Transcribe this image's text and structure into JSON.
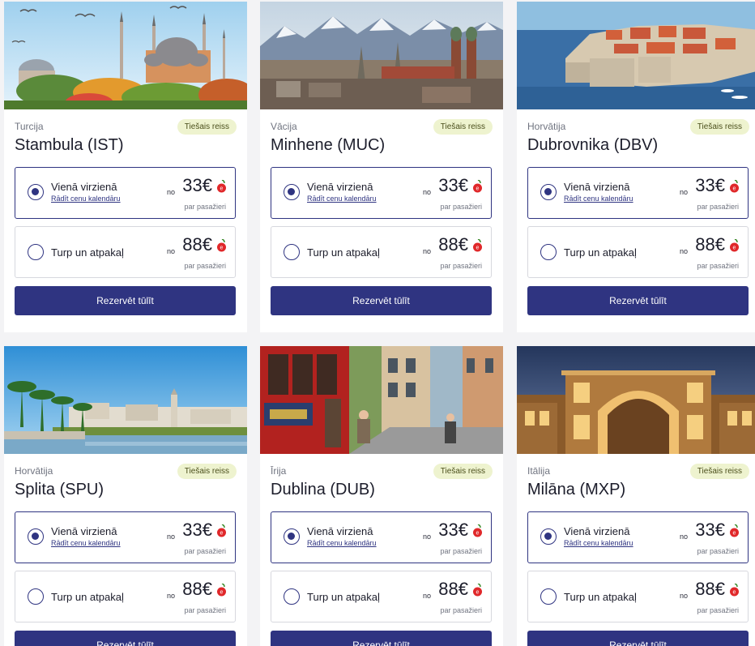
{
  "destinations": [
    {
      "country": "Turcija",
      "badge": "Tiešais reiss",
      "city": "Stambula (IST)",
      "oneway_label": "Vienā virzienā",
      "calendar_link": "Rādīt cenu kalendāru",
      "from": "no",
      "oneway_price": "33€",
      "per_passenger": "par pasažieri",
      "return_label": "Turp un atpakaļ",
      "return_price": "88€",
      "book_label": "Rezervēt tūlīt"
    },
    {
      "country": "Vācija",
      "badge": "Tiešais reiss",
      "city": "Minhene (MUC)",
      "oneway_label": "Vienā virzienā",
      "calendar_link": "Rādīt cenu kalendāru",
      "from": "no",
      "oneway_price": "33€",
      "per_passenger": "par pasažieri",
      "return_label": "Turp un atpakaļ",
      "return_price": "88€",
      "book_label": "Rezervēt tūlīt"
    },
    {
      "country": "Horvātija",
      "badge": "Tiešais reiss",
      "city": "Dubrovnika (DBV)",
      "oneway_label": "Vienā virzienā",
      "calendar_link": "Rādīt cenu kalendāru",
      "from": "no",
      "oneway_price": "33€",
      "per_passenger": "par pasažieri",
      "return_label": "Turp un atpakaļ",
      "return_price": "88€",
      "book_label": "Rezervēt tūlīt"
    },
    {
      "country": "Horvātija",
      "badge": "Tiešais reiss",
      "city": "Splita (SPU)",
      "oneway_label": "Vienā virzienā",
      "calendar_link": "Rādīt cenu kalendāru",
      "from": "no",
      "oneway_price": "33€",
      "per_passenger": "par pasažieri",
      "return_label": "Turp un atpakaļ",
      "return_price": "88€",
      "book_label": "Rezervēt tūlīt"
    },
    {
      "country": "Īrija",
      "badge": "Tiešais reiss",
      "city": "Dublina (DUB)",
      "oneway_label": "Vienā virzienā",
      "calendar_link": "Rādīt cenu kalendāru",
      "from": "no",
      "oneway_price": "33€",
      "per_passenger": "par pasažieri",
      "return_label": "Turp un atpakaļ",
      "return_price": "88€",
      "book_label": "Rezervēt tūlīt"
    },
    {
      "country": "Itālija",
      "badge": "Tiešais reiss",
      "city": "Milāna (MXP)",
      "oneway_label": "Vienā virzienā",
      "calendar_link": "Rādīt cenu kalendāru",
      "from": "no",
      "oneway_price": "33€",
      "per_passenger": "par pasažieri",
      "return_label": "Turp un atpakaļ",
      "return_price": "88€",
      "book_label": "Rezervēt tūlīt"
    }
  ],
  "colors": {
    "primary": "#2f3481",
    "badge_bg": "#eef3cf",
    "price_icon": "#e0282a"
  },
  "icons": {
    "price_icon": "cherry-price-icon",
    "radio": "radio-icon"
  }
}
